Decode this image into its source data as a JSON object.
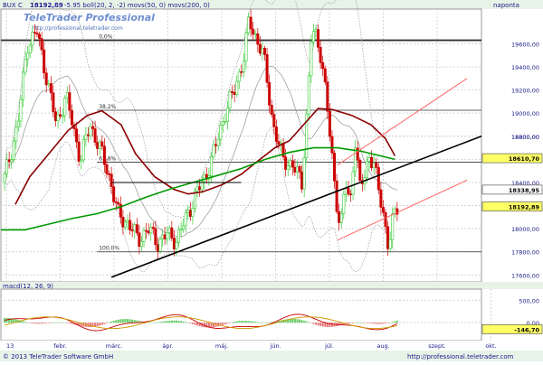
{
  "header": {
    "ticker": "BUX C",
    "price": "18192,89",
    "indicators": "-5.95 boll(20, 2, -2) movs(50, 0) movs(200, 0)",
    "period": "naponta"
  },
  "footer": {
    "copyright": "© 2013 TeleTrader Software GmbH",
    "url": "http://professional.teletrader.com"
  },
  "watermark": {
    "brand": "TeleTrader Professional",
    "url": "http://professional.teletrader.com"
  },
  "macd_label": "macd(12, 26, 9)",
  "colors": {
    "up_candle": "#33cc33",
    "down_candle": "#cc0000",
    "ma50": "#8b0000",
    "ma200": "#009900",
    "bollinger": "#999999",
    "trendline": "#000000",
    "channel": "#ff6666",
    "fib": "#333333",
    "price_tag": "#ffff66"
  },
  "chart_data": [
    {
      "type": "candlestick",
      "title": "BUX",
      "x_tick_labels": [
        "13",
        "febr.",
        "márc.",
        "ápr.",
        "máj.",
        "jún.",
        "júl.",
        "aug.",
        "szept.",
        "okt."
      ],
      "y_tick_labels": [
        "18800,00",
        "19600,00",
        "19400,00",
        "19200,00",
        "19000,00",
        "18800,00",
        "18600,00",
        "18400,00",
        "18200,00",
        "18000,00",
        "17800,00",
        "17600,00"
      ],
      "ylim": [
        17540,
        19900
      ],
      "fib_levels": [
        {
          "label": "0,0%",
          "value": 19630
        },
        {
          "label": "38,2%",
          "value": 19025
        },
        {
          "label": "61,8%",
          "value": 18575
        },
        {
          "label": "100,0%",
          "value": 17800
        }
      ],
      "price_tags": [
        {
          "label": "18610,70",
          "value": 18610,
          "color": "#ffff66"
        },
        {
          "label": "18338,95",
          "value": 18338,
          "color": "#ffffff"
        },
        {
          "label": "18192,89",
          "value": 18192,
          "color": "#ffff66"
        }
      ],
      "series": [
        {
          "name": "movs(50, 0)",
          "keyframes": [
            [
              0.03,
              18210
            ],
            [
              0.06,
              18450
            ],
            [
              0.1,
              18650
            ],
            [
              0.14,
              18850
            ],
            [
              0.18,
              18980
            ],
            [
              0.21,
              19020
            ],
            [
              0.25,
              18900
            ],
            [
              0.28,
              18650
            ],
            [
              0.32,
              18450
            ],
            [
              0.36,
              18340
            ],
            [
              0.39,
              18300
            ],
            [
              0.42,
              18320
            ],
            [
              0.46,
              18380
            ],
            [
              0.5,
              18470
            ],
            [
              0.53,
              18570
            ],
            [
              0.57,
              18700
            ],
            [
              0.6,
              18760
            ],
            [
              0.63,
              18900
            ],
            [
              0.66,
              19040
            ],
            [
              0.69,
              19030
            ],
            [
              0.73,
              18980
            ],
            [
              0.77,
              18900
            ],
            [
              0.8,
              18780
            ],
            [
              0.82,
              18630
            ]
          ]
        },
        {
          "name": "movs(200, 0)",
          "keyframes": [
            [
              0.0,
              17990
            ],
            [
              0.05,
              17990
            ],
            [
              0.1,
              18040
            ],
            [
              0.15,
              18090
            ],
            [
              0.2,
              18130
            ],
            [
              0.25,
              18190
            ],
            [
              0.3,
              18270
            ],
            [
              0.35,
              18340
            ],
            [
              0.4,
              18400
            ],
            [
              0.45,
              18460
            ],
            [
              0.5,
              18520
            ],
            [
              0.55,
              18600
            ],
            [
              0.6,
              18660
            ],
            [
              0.65,
              18700
            ],
            [
              0.7,
              18700
            ],
            [
              0.75,
              18670
            ],
            [
              0.82,
              18600
            ]
          ]
        }
      ],
      "ohlc_keyframes": [
        [
          0.0,
          18400
        ],
        [
          0.03,
          18900
        ],
        [
          0.05,
          19600
        ],
        [
          0.07,
          19700
        ],
        [
          0.09,
          19300
        ],
        [
          0.11,
          18900
        ],
        [
          0.13,
          19150
        ],
        [
          0.16,
          18600
        ],
        [
          0.18,
          18900
        ],
        [
          0.2,
          18700
        ],
        [
          0.22,
          18450
        ],
        [
          0.24,
          18100
        ],
        [
          0.26,
          18050
        ],
        [
          0.28,
          17900
        ],
        [
          0.3,
          18000
        ],
        [
          0.32,
          17880
        ],
        [
          0.34,
          17950
        ],
        [
          0.36,
          17900
        ],
        [
          0.38,
          18100
        ],
        [
          0.4,
          18300
        ],
        [
          0.42,
          18450
        ],
        [
          0.44,
          18700
        ],
        [
          0.46,
          19000
        ],
        [
          0.48,
          19200
        ],
        [
          0.5,
          19500
        ],
        [
          0.51,
          19800
        ],
        [
          0.52,
          19700
        ],
        [
          0.54,
          19500
        ],
        [
          0.55,
          19200
        ],
        [
          0.56,
          18900
        ],
        [
          0.58,
          18600
        ],
        [
          0.6,
          18550
        ],
        [
          0.62,
          18400
        ],
        [
          0.63,
          19000
        ],
        [
          0.64,
          19700
        ],
        [
          0.65,
          19650
        ],
        [
          0.66,
          19500
        ],
        [
          0.67,
          19150
        ],
        [
          0.68,
          18700
        ],
        [
          0.69,
          18300
        ],
        [
          0.7,
          18000
        ],
        [
          0.71,
          18400
        ],
        [
          0.72,
          18200
        ],
        [
          0.73,
          18800
        ],
        [
          0.74,
          18350
        ],
        [
          0.75,
          18450
        ],
        [
          0.76,
          18650
        ],
        [
          0.77,
          18550
        ],
        [
          0.78,
          18300
        ],
        [
          0.79,
          18100
        ],
        [
          0.8,
          17850
        ],
        [
          0.81,
          18100
        ],
        [
          0.82,
          18192
        ]
      ]
    },
    {
      "type": "bar",
      "title": "macd(12, 26, 9)",
      "y_tick_labels": [
        "500,00",
        "0,00"
      ],
      "ylim": [
        -400,
        750
      ],
      "price_tags": [
        {
          "label": "-146,70",
          "value": -146,
          "color": "#ffff66"
        }
      ]
    }
  ]
}
